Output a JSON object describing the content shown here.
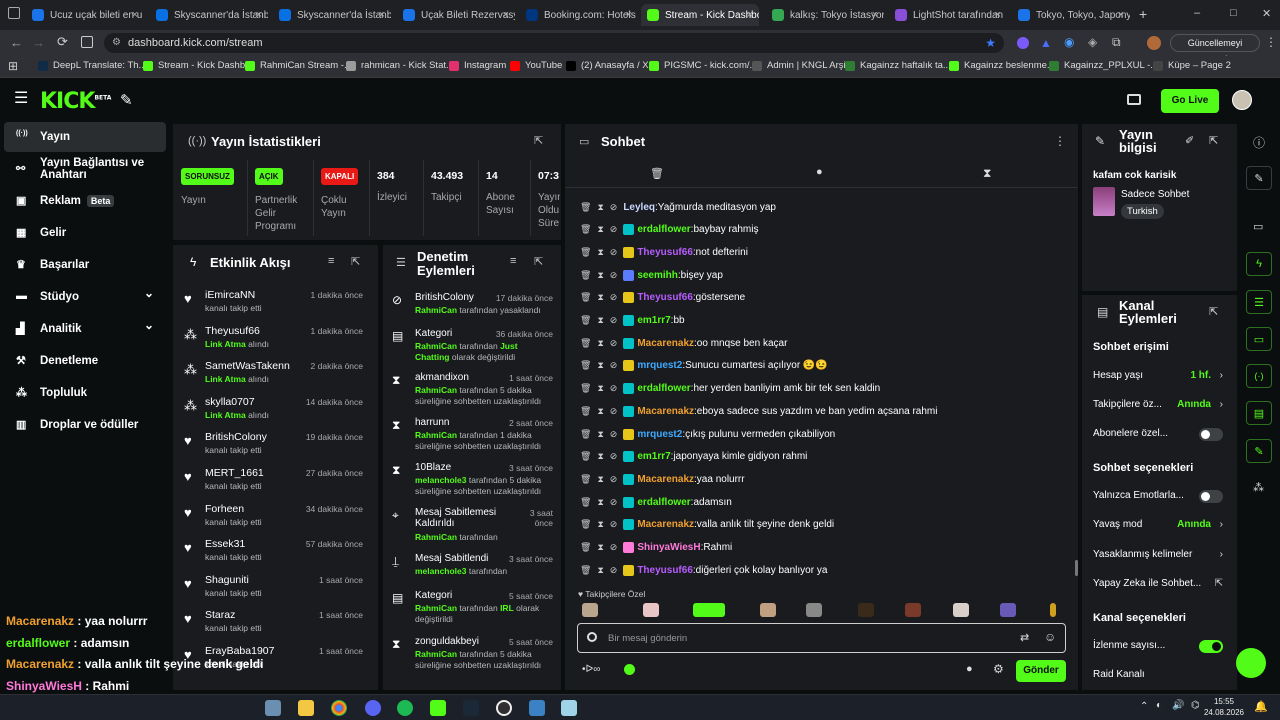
{
  "browser": {
    "tabs": [
      {
        "label": "Ucuz uçak bileti en u",
        "color": "#1a73e8"
      },
      {
        "label": "Skyscanner'da İstanb",
        "color": "#0770e3"
      },
      {
        "label": "Skyscanner'da İstanb",
        "color": "#0770e3"
      },
      {
        "label": "Uçak Bileti Rezervasy",
        "color": "#1a73e8"
      },
      {
        "label": "Booking.com: Hotels",
        "color": "#003580"
      },
      {
        "label": "Stream - Kick Dashbo",
        "color": "#53fc18"
      },
      {
        "label": "kalkış: Tokyo İstasyon",
        "color": "#34a853"
      },
      {
        "label": "LightShot tarafından",
        "color": "#8a4fd8"
      },
      {
        "label": "Tokyo, Tokyo, Japony",
        "color": "#1a73e8"
      }
    ],
    "url": "dashboard.kick.com/stream",
    "update_label": "Güncellemeyi tamamla",
    "bookmarks": [
      {
        "label": "DeepL Translate: Th...",
        "color": "#0f2b46"
      },
      {
        "label": "Stream - Kick Dashb...",
        "color": "#53fc18"
      },
      {
        "label": "RahmiCan Stream -...",
        "color": "#53fc18"
      },
      {
        "label": "rahmican - Kick Stat...",
        "color": "#9b9b9b"
      },
      {
        "label": "Instagram",
        "color": "#e1306c"
      },
      {
        "label": "YouTube",
        "color": "#ff0000"
      },
      {
        "label": "(2) Anasayfa / X",
        "color": "#000000"
      },
      {
        "label": "PIGSMC - kick.com/...",
        "color": "#53fc18"
      },
      {
        "label": "Admin | KNGL Arşiv",
        "color": "#555555"
      },
      {
        "label": "Kagainzz haftalık ta...",
        "color": "#2e7d32"
      },
      {
        "label": "Kagainzz beslenme...",
        "color": "#53fc18"
      },
      {
        "label": "Kagainzz_PPLXUL -...",
        "color": "#2e7d32"
      },
      {
        "label": "Küpe – Page 2",
        "color": "#444444"
      }
    ]
  },
  "kick": {
    "logo": "KICK",
    "logo_beta": "BETA",
    "go_live": "Go Live"
  },
  "sidebar": {
    "items": [
      {
        "label": "Yayın",
        "icon": "broadcast-icon"
      },
      {
        "label": "Yayın Bağlantısı ve Anahtarı",
        "icon": "link-icon"
      },
      {
        "label": "Reklam",
        "icon": "ad-icon",
        "badge": "Beta"
      },
      {
        "label": "Gelir",
        "icon": "revenue-icon"
      },
      {
        "label": "Başarılar",
        "icon": "trophy-icon"
      },
      {
        "label": "Stüdyo",
        "icon": "studio-icon"
      },
      {
        "label": "Analitik",
        "icon": "analytics-icon"
      },
      {
        "label": "Denetleme",
        "icon": "moderation-icon"
      },
      {
        "label": "Topluluk",
        "icon": "community-icon"
      },
      {
        "label": "Droplar ve ödüller",
        "icon": "drops-icon"
      }
    ]
  },
  "stats": {
    "title": "Yayın İstatistikleri",
    "items": [
      {
        "badge": "SORUNSUZ",
        "badge_color": "#53fc18",
        "label": "Yayın"
      },
      {
        "badge": "AÇIK",
        "badge_color": "#53fc18",
        "label": "Partnerlik Gelir Programı"
      },
      {
        "badge": "KAPALI",
        "badge_color": "#e91916",
        "label": "Çoklu Yayın"
      },
      {
        "value": "384",
        "label": "İzleyici"
      },
      {
        "value": "43.493",
        "label": "Takipçi"
      },
      {
        "value": "14",
        "label": "Abone Sayısı"
      },
      {
        "value": "07:3",
        "label": "Yayın Oldu Süre"
      }
    ]
  },
  "activity": {
    "title": "Etkinlik Akışı",
    "items": [
      {
        "name": "iEmircaNN",
        "sub": "kanalı takip etti",
        "time": "1 dakika önce",
        "kind": "follow"
      },
      {
        "name": "Theyusuf66",
        "sub_b": "Link Atma",
        "sub": " alındı",
        "time": "1 dakika önce",
        "kind": "reward"
      },
      {
        "name": "SametWasTakenn",
        "sub_b": "Link Atma",
        "sub": " alındı",
        "time": "2 dakika önce",
        "kind": "reward"
      },
      {
        "name": "skylla0707",
        "sub_b": "Link Atma",
        "sub": " alındı",
        "time": "14 dakika önce",
        "kind": "reward"
      },
      {
        "name": "BritishColony",
        "sub": "kanalı takip etti",
        "time": "19 dakika önce",
        "kind": "follow"
      },
      {
        "name": "MERT_1661",
        "sub": "kanalı takip etti",
        "time": "27 dakika önce",
        "kind": "follow"
      },
      {
        "name": "Forheen",
        "sub": "kanalı takip etti",
        "time": "34 dakika önce",
        "kind": "follow"
      },
      {
        "name": "Essek31",
        "sub": "kanalı takip etti",
        "time": "57 dakika önce",
        "kind": "follow"
      },
      {
        "name": "Shaguniti",
        "sub": "kanalı takip etti",
        "time": "1 saat önce",
        "kind": "follow"
      },
      {
        "name": "Staraz",
        "sub": "kanalı takip etti",
        "time": "1 saat önce",
        "kind": "follow"
      },
      {
        "name": "ErayBaba1907",
        "sub": "kanalı takip etti",
        "time": "1 saat önce",
        "kind": "follow"
      }
    ]
  },
  "moderation": {
    "title": "Denetim Eylemleri",
    "items": [
      {
        "name": "BritishColony",
        "sub_b": "RahmiCan",
        "sub": " tarafından yasaklandı",
        "time": "17 dakika önce",
        "kind": "ban"
      },
      {
        "name": "Kategori",
        "sub_b": "RahmiCan",
        "sub": " tarafından ",
        "sub_b2": "Just Chatting",
        "sub2": " olarak değiştirildi",
        "time": "36 dakika önce",
        "kind": "category"
      },
      {
        "name": "akmandixon",
        "sub_b": "RahmiCan",
        "sub": " tarafından 5 dakika süreliğine sohbetten uzaklaştırıldı",
        "time": "1 saat önce",
        "kind": "timeout"
      },
      {
        "name": "harrunn",
        "sub_b": "RahmiCan",
        "sub": " tarafından 1 dakika süreliğine sohbetten uzaklaştırıldı",
        "time": "2 saat önce",
        "kind": "timeout"
      },
      {
        "name": "10Blaze",
        "sub_b": "melancholе3",
        "sub": " tarafından 5 dakika süreliğine sohbetten uzaklaştırıldı",
        "time": "3 saat önce",
        "kind": "timeout"
      },
      {
        "name": "Mesaj Sabitlemesi Kaldırıldı",
        "sub_b": "RahmiCan",
        "sub": " tarafından",
        "time": "3 saat önce",
        "kind": "unpin"
      },
      {
        "name": "Mesaj Sabitlendi",
        "sub_b": "melancholе3",
        "sub": " tarafından",
        "time": "3 saat önce",
        "kind": "pin"
      },
      {
        "name": "Kategori",
        "sub_b": "RahmiCan",
        "sub": " tarafından ",
        "sub_b2": "IRL",
        "sub2": " olarak değiştirildi",
        "time": "5 saat önce",
        "kind": "category"
      },
      {
        "name": "zonguldakbeyi",
        "sub_b": "RahmiCan",
        "sub": " tarafından 5 dakika süreliğine sohbetten uzaklaştırıldı",
        "time": "5 saat önce",
        "kind": "timeout"
      }
    ]
  },
  "chat": {
    "title": "Sohbet",
    "messages": [
      {
        "user": "Leyleq",
        "color": "#c9d7ff",
        "text": "Yağmurda meditasyon yap",
        "badge": ""
      },
      {
        "user": "erdalflower",
        "color": "#53fc18",
        "text": "baybay rahmiş",
        "badge": "#00c2c7"
      },
      {
        "user": "Theyusuf66",
        "color": "#b85cff",
        "text": "not defterini",
        "badge": "#e6c619"
      },
      {
        "user": "seemihh",
        "color": "#53fc18",
        "text": "bişey yap",
        "badge": "#5b7cff"
      },
      {
        "user": "Theyusuf66",
        "color": "#b85cff",
        "text": "göstersene",
        "badge": "#e6c619"
      },
      {
        "user": "em1rr7",
        "color": "#53fc18",
        "text": "bb",
        "badge": "#00c2c7"
      },
      {
        "user": "Macarenakz",
        "color": "#f0a030",
        "text": "oo mnqse ben kaçar",
        "badge": "#00c2c7"
      },
      {
        "user": "mrquest2",
        "color": "#3fa9ff",
        "text": "Sunucu cumartesi açılıyor 😉😉",
        "badge": "#e6c619"
      },
      {
        "user": "erdalflower",
        "color": "#53fc18",
        "text": "her yerden banliyim amk bir tek sen kaldin",
        "badge": "#00c2c7"
      },
      {
        "user": "Macarenakz",
        "color": "#f0a030",
        "text": "eboya sadece sus yazdım ve ban yedim açsana rahmi",
        "badge": "#00c2c7"
      },
      {
        "user": "mrquest2",
        "color": "#3fa9ff",
        "text": "çıkış pulunu vermeden çıkabiliyon",
        "badge": "#e6c619"
      },
      {
        "user": "em1rr7",
        "color": "#53fc18",
        "text": "japonyaya kimle gidiyon rahmi",
        "badge": "#00c2c7"
      },
      {
        "user": "Macarenakz",
        "color": "#f0a030",
        "text": "yaa nolurrr",
        "badge": "#00c2c7"
      },
      {
        "user": "erdalflower",
        "color": "#53fc18",
        "text": "adamsın",
        "badge": "#00c2c7"
      },
      {
        "user": "Macarenakz",
        "color": "#f0a030",
        "text": "valla anlık tilt şeyine denk geldi",
        "badge": "#00c2c7"
      },
      {
        "user": "ShinyaWiesH",
        "color": "#ff7ad9",
        "text": "Rahmi",
        "badge": "#ff7ad9"
      },
      {
        "user": "Theyusuf66",
        "color": "#b85cff",
        "text": "diğerleri çok kolay banlıyor ya",
        "badge": "#e6c619"
      }
    ],
    "emote_label": "Takipçilere Özel",
    "input_placeholder": "Bir mesaj gönderin",
    "send_label": "Gönder"
  },
  "stream_info": {
    "title": "Yayın bilgisi",
    "stream_title": "kafam cok karisik",
    "category": "Sadece Sohbet",
    "tag": "Turkish"
  },
  "channel_actions": {
    "title": "Kanal Eylemleri",
    "chat_access": "Sohbet erişimi",
    "account_age": "Hesap yaşı",
    "account_age_val": "1 hf.",
    "followers_only": "Takipçilere öz...",
    "followers_only_val": "Anında",
    "subs_only": "Abonelere özel...",
    "chat_options": "Sohbet seçenekleri",
    "emotes_only": "Yalnızca Emotlarla...",
    "slow_mode": "Yavaş mod",
    "slow_mode_val": "Anında",
    "banned_words": "Yasaklanmış kelimeler",
    "ai_chat": "Yapay Zeka ile Sohbet...",
    "channel_options": "Kanal seçenekleri",
    "viewer_count": "İzlenme sayısı...",
    "raid": "Raid Kanalı"
  },
  "overlay": [
    {
      "user": "Macarenakz",
      "color": "#f0a030",
      "text": "yaa nolurrr"
    },
    {
      "user": "erdalflower",
      "color": "#53fc18",
      "text": "adamsın"
    },
    {
      "user": "Macarenakz",
      "color": "#f0a030",
      "text": "valla anlık tilt şeyine denk geldi"
    },
    {
      "user": "ShinyaWiesH",
      "color": "#ff7ad9",
      "text": "Rahmi"
    },
    {
      "user": "Theyusuf66",
      "color": "#b85cff",
      "text": "diğerleri çok kolay banlıyor ya"
    }
  ],
  "taskbar": {
    "time": "15:55",
    "date": "24.08.2026"
  }
}
